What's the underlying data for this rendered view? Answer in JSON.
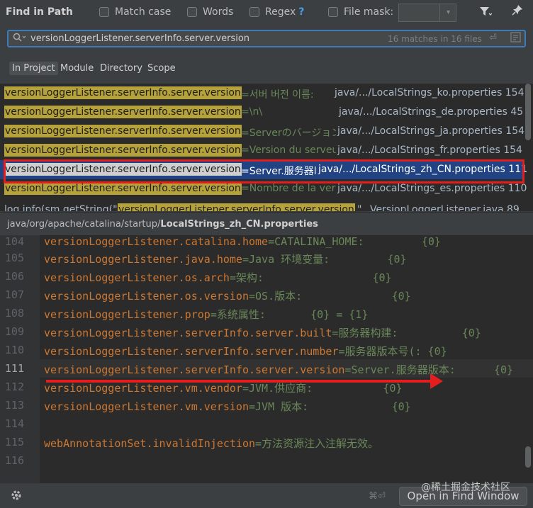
{
  "title": "Find in Path",
  "options": {
    "match_case": "Match case",
    "words": "Words",
    "regex": "Regex",
    "regex_help": "?",
    "file_mask": "File mask:"
  },
  "search": {
    "query": "versionLoggerListener.serverInfo.server.version",
    "match_count": "16 matches in 16 files"
  },
  "scope_tabs": [
    "In Project",
    "Module",
    "Directory",
    "Scope"
  ],
  "results": [
    {
      "match": "versionLoggerListener.serverInfo.server.version",
      "rest": "=서버 버전 이름:",
      "path": "java/.../LocalStrings_ko.properties 154"
    },
    {
      "match": "versionLoggerListener.serverInfo.server.version",
      "rest": "=\\n\\",
      "path": "java/.../LocalStrings_de.properties 45"
    },
    {
      "match": "versionLoggerListener.serverInfo.server.version",
      "rest": "=Serverのバージョン",
      "path": "java/.../LocalStrings_ja.properties 154"
    },
    {
      "match": "versionLoggerListener.serverInfo.server.version",
      "rest": "=Version du serveu",
      "path": "java/.../LocalStrings_fr.properties 154"
    },
    {
      "match": "versionLoggerListener.serverInfo.server.version",
      "rest": "=Server.服务器l",
      "path": "java/.../LocalStrings_zh_CN.properties 111"
    },
    {
      "match": "versionLoggerListener.serverInfo.server.version",
      "rest": "=Nombre de la vers",
      "path": "java/.../LocalStrings_es.properties 110"
    },
    {
      "prefix": "log.info(sm.getString(\"",
      "match": "versionLoggerListener.serverInfo.server.version",
      "rest": "\"",
      "path": "VersionLoggerListener.java 89"
    }
  ],
  "file_path": {
    "dir": "java/org/apache/catalina/startup/",
    "file": "LocalStrings_zh_CN.properties"
  },
  "editor": {
    "lines": [
      {
        "n": "104",
        "key": "versionLoggerListener.catalina.home",
        "value": "=CATALINA_HOME:         {0}"
      },
      {
        "n": "105",
        "key": "versionLoggerListener.java.home",
        "value": "=Java 环境变量:         {0}"
      },
      {
        "n": "106",
        "key": "versionLoggerListener.os.arch",
        "value": "=架构:                 {0}"
      },
      {
        "n": "107",
        "key": "versionLoggerListener.os.version",
        "value": "=OS.版本:              {0}"
      },
      {
        "n": "108",
        "key": "versionLoggerListener.prop",
        "value": "=系统属性:       {0} = {1}"
      },
      {
        "n": "109",
        "key": "versionLoggerListener.serverInfo.server.built",
        "value": "=服务器构建:          {0}"
      },
      {
        "n": "110",
        "key": "versionLoggerListener.serverInfo.server.number",
        "value": "=服务器版本号(: {0}"
      },
      {
        "n": "111",
        "key": "versionLoggerListener.serverInfo.server.version",
        "value": "=Server.服务器版本:      {0}"
      },
      {
        "n": "112",
        "key": "versionLoggerListener.vm.vendor",
        "value": "=JVM.供应商:           {0}"
      },
      {
        "n": "113",
        "key": "versionLoggerListener.vm.version",
        "value": "=JVM 版本:             {0}"
      },
      {
        "n": "114",
        "key": "",
        "value": ""
      },
      {
        "n": "115",
        "key": "webAnnotationSet.invalidInjection",
        "value": "=方法资源注入注解无效。"
      },
      {
        "n": "116",
        "key": "",
        "value": ""
      }
    ]
  },
  "bottom": {
    "shortcut": "⌘⏎",
    "open_button": "Open in Find Window",
    "watermark": "@稀土掘金技术社区"
  },
  "colors": {
    "accent": "#3d7bbd",
    "selection": "#214283",
    "highlight": "#b6a23a",
    "annotation": "#e41e1e"
  },
  "icons": [
    "filter-icon",
    "pin-icon",
    "search-icon",
    "enter-icon",
    "regex-icon",
    "settings-icon"
  ]
}
